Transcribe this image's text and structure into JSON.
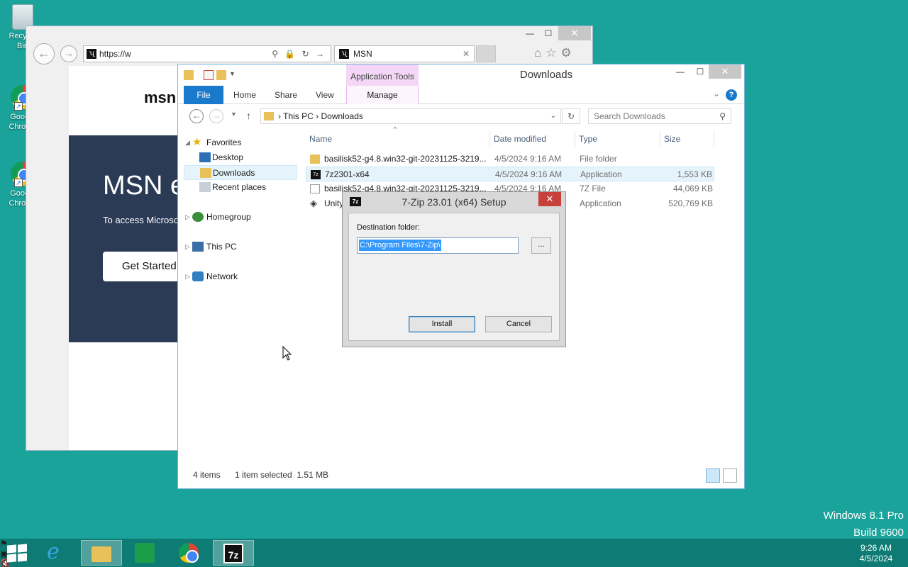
{
  "desktop": {
    "icons": [
      {
        "label": "Recycle Bin",
        "icon": "recycle-bin-icon"
      },
      {
        "label": "Google Chrome",
        "icon": "chrome-icon"
      },
      {
        "label": "Google Chrome",
        "icon": "chrome-icon"
      }
    ],
    "watermark": {
      "line1": "Windows 8.1 Pro",
      "line2": "Build 9600"
    }
  },
  "ie": {
    "address": "https://w",
    "tab_title": "MSN",
    "page": {
      "logo": "msn",
      "headline": "MSN e",
      "subtext": "To access Microso",
      "button": "Get Started"
    }
  },
  "explorer": {
    "title": "Downloads",
    "contextual_group": "Application Tools",
    "ribbon_tabs": [
      "File",
      "Home",
      "Share",
      "View",
      "Manage"
    ],
    "breadcrumb": [
      "This PC",
      "Downloads"
    ],
    "search_placeholder": "Search Downloads",
    "nav": {
      "favorites": "Favorites",
      "desktop": "Desktop",
      "downloads": "Downloads",
      "recent": "Recent places",
      "homegroup": "Homegroup",
      "thispc": "This PC",
      "network": "Network"
    },
    "columns": {
      "name": "Name",
      "date": "Date modified",
      "type": "Type",
      "size": "Size"
    },
    "files": [
      {
        "name": "basilisk52-g4.8.win32-git-20231125-3219...",
        "date": "4/5/2024 9:16 AM",
        "type": "File folder",
        "size": "",
        "icon": "folder-icon"
      },
      {
        "name": "7z2301-x64",
        "date": "4/5/2024 9:16 AM",
        "type": "Application",
        "size": "1,553 KB",
        "icon": "7zip-icon"
      },
      {
        "name": "basilisk52-g4.8.win32-git-20231125-3219...",
        "date": "4/5/2024 9:16 AM",
        "type": "7Z File",
        "size": "44,069 KB",
        "icon": "file-icon"
      },
      {
        "name": "Unity",
        "date": "",
        "type": "Application",
        "size": "520,769 KB",
        "icon": "unity-icon"
      }
    ],
    "status": {
      "count": "4 items",
      "selection": "1 item selected  1.51 MB"
    }
  },
  "dialog": {
    "title": "7-Zip 23.01 (x64) Setup",
    "label": "Destination folder:",
    "path": "C:\\Program Files\\7-Zip\\",
    "browse": "...",
    "install": "Install",
    "cancel": "Cancel"
  },
  "taskbar": {
    "time": "9:26 AM",
    "date": "4/5/2024"
  },
  "colors": {
    "desktop": "#19a39a",
    "taskbar": "#0e7c75",
    "ribbon_file": "#1979ca",
    "contextual_tab": "#f4d7f7"
  }
}
